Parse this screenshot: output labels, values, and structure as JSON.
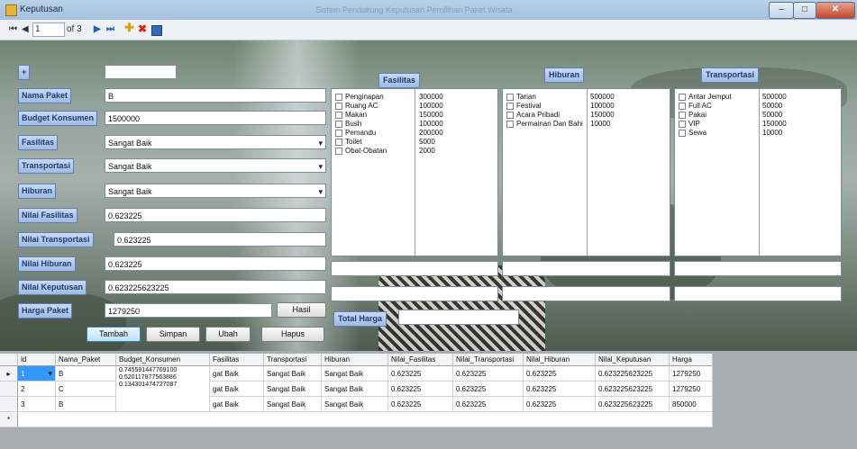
{
  "window": {
    "title": "Keputusan",
    "blurred_title": "Sistem Pendukung Keputusan Pemilihan Paket Wisata",
    "controls": {
      "minimize": "–",
      "maximize": "□",
      "close": "✕"
    }
  },
  "navigator": {
    "first": "⏮",
    "prev": "◀",
    "position": "1",
    "count": "of 3",
    "next": "▶",
    "last": "⏭"
  },
  "form": {
    "add_label": "+",
    "id_value": "1",
    "labels": {
      "nama_paket": "Nama Paket",
      "budget": "Budget Konsumen",
      "fasilitas": "Fasilitas",
      "transportasi": "Transportasi",
      "hiburan": "Hiburan",
      "nilai_fasilitas": "Nilai Fasilitas",
      "nilai_transportasi": "Nilai Transportasi",
      "nilai_hiburan": "Nilai Hiburan",
      "nilai_keputusan": "Nilai Keputusan",
      "harga_paket": "Harga Paket"
    },
    "values": {
      "nama_paket": "B",
      "budget": "1500000",
      "fasilitas": "Sangat Baik",
      "transportasi": "Sangat Baik",
      "hiburan": "Sangat Baik",
      "nilai_fasilitas": "0.623225",
      "nilai_transportasi": "0.623225",
      "nilai_hiburan": "0.623225",
      "nilai_keputusan": "0.623225623225",
      "harga_paket": "1279250"
    },
    "buttons": {
      "hasil": "Hasil",
      "tambah": "Tambah",
      "simpan": "Simpan",
      "ubah": "Ubah",
      "hapus": "Hapus"
    }
  },
  "groups": {
    "fasilitas": {
      "title": "Fasilitas",
      "items": [
        {
          "name": "Penginapan",
          "price": "300000"
        },
        {
          "name": "Ruang AC",
          "price": "100000"
        },
        {
          "name": "Makan",
          "price": "150000"
        },
        {
          "name": "Bush",
          "price": "100000"
        },
        {
          "name": "Pemandu",
          "price": "200000"
        },
        {
          "name": "Toilet",
          "price": "5000"
        },
        {
          "name": "Obat-Obatan",
          "price": "2000"
        }
      ]
    },
    "hiburan": {
      "title": "Hiburan",
      "items": [
        {
          "name": "Tarian",
          "price": "500000"
        },
        {
          "name": "Festival",
          "price": "100000"
        },
        {
          "name": "Acara Pribadi",
          "price": "150000"
        },
        {
          "name": "Permainan Dan Bahi",
          "price": "10000"
        }
      ]
    },
    "transportasi": {
      "title": "Transportasi",
      "items": [
        {
          "name": "Antar Jemput",
          "price": "500000"
        },
        {
          "name": "Full AC",
          "price": "50000"
        },
        {
          "name": "Pakai",
          "price": "50000"
        },
        {
          "name": "VIP",
          "price": "150000"
        },
        {
          "name": "Sewa",
          "price": "10000"
        }
      ]
    },
    "total_harga_label": "Total Harga",
    "total_harga_value": ""
  },
  "grid": {
    "columns": [
      "id",
      "Nama_Paket",
      "Budget_Konsumen",
      "Fasilitas",
      "Transportasi",
      "Hiburan",
      "Nilai_Fasilitas",
      "Nilai_Transportasi",
      "Nilai_Hiburan",
      "Nilai_Keputusan",
      "Harga"
    ],
    "rows": [
      {
        "marker": "▸",
        "id": "1",
        "nama": "B",
        "budget": [
          "0.745591447769100",
          "0.520117877563886",
          "0.134301474727087"
        ],
        "fasilitas": "gat Baik",
        "transportasi": "Sangat Baik",
        "hiburan": "Sangat Baik",
        "nf": "0.623225",
        "nt": "0.623225",
        "nh": "0.623225",
        "nk": "0.623225623225",
        "harga": "1279250"
      },
      {
        "marker": "",
        "id": "2",
        "nama": "C",
        "budget": [],
        "fasilitas": "gat Baik",
        "transportasi": "Sangat Baik",
        "hiburan": "Sangat Baik",
        "nf": "0.623225",
        "nt": "0.623225",
        "nh": "0.623225",
        "nk": "0.623225623225",
        "harga": "1279250"
      },
      {
        "marker": "",
        "id": "3",
        "nama": "B",
        "budget": [],
        "fasilitas": "gat Baik",
        "transportasi": "Sangat Baik",
        "hiburan": "Sangat Baik",
        "nf": "0.623225",
        "nt": "0.623225",
        "nh": "0.623225",
        "nk": "0.623225623225",
        "harga": "850000"
      }
    ],
    "new_row_marker": "*"
  }
}
